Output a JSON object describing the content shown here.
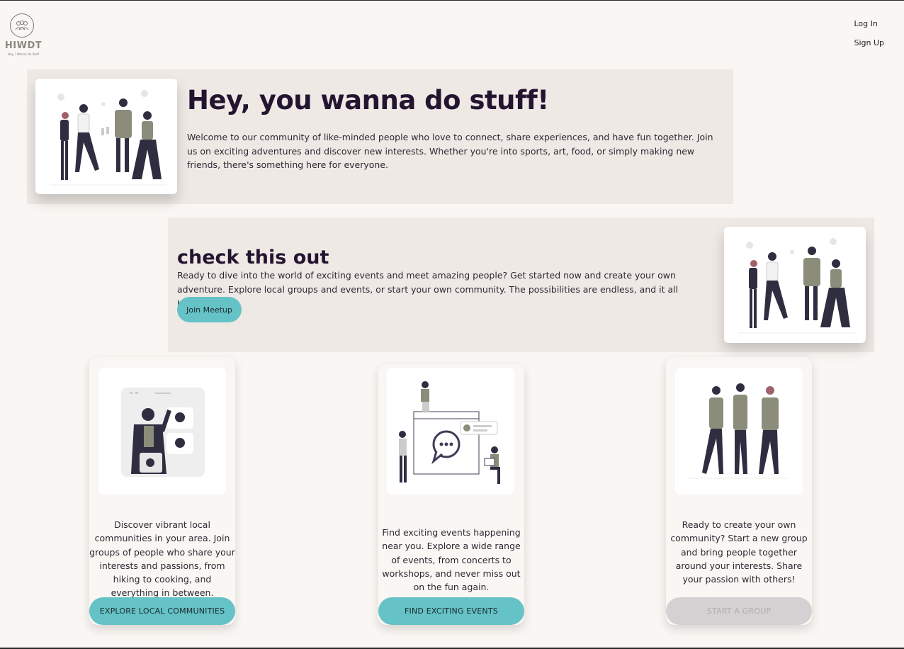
{
  "brand": {
    "wordmark": "HIWDT",
    "tagline": "Hey, I Wanna Do Stuff"
  },
  "nav": {
    "login": "Log In",
    "signup": "Sign Up"
  },
  "hero": {
    "title": "Hey, you wanna do stuff!",
    "body": "Welcome to our community of like-minded people who love to connect, share experiences, and have fun together. Join us on exciting adventures and discover new interests. Whether you're into sports, art, food, or simply making new friends, there's something here for everyone."
  },
  "promo": {
    "title": "check this out",
    "body": "Ready to dive into the world of exciting events and meet amazing people? Get started now and create your own adventure. Explore local groups and events, or start your own community. The possibilities are endless, and it all begins here!",
    "button": "Join Meetup"
  },
  "cards": [
    {
      "text": "Discover vibrant local communities in your area. Join groups of people who share your interests and passions, from hiking to cooking, and everything in between.",
      "button": "EXPLORE LOCAL COMMUNITIES"
    },
    {
      "text": "Find exciting events happening near you. Explore a wide range of events, from concerts to workshops, and never miss out on the fun again.",
      "button": "FIND EXCITING EVENTS"
    },
    {
      "text": "Ready to create your own community? Start a new group and bring people together around your interests. Share your passion with others!",
      "button": "START A GROUP"
    }
  ],
  "colors": {
    "accent": "#65c2c6",
    "heading": "#231530",
    "panel": "#efe9e5",
    "background": "#faf6f3",
    "disabled": "#d5d1d2"
  },
  "icons": [
    "people-logo-icon",
    "group-toasting-illustration",
    "video-call-illustration",
    "chat-events-illustration",
    "friends-holding-hands-illustration"
  ]
}
